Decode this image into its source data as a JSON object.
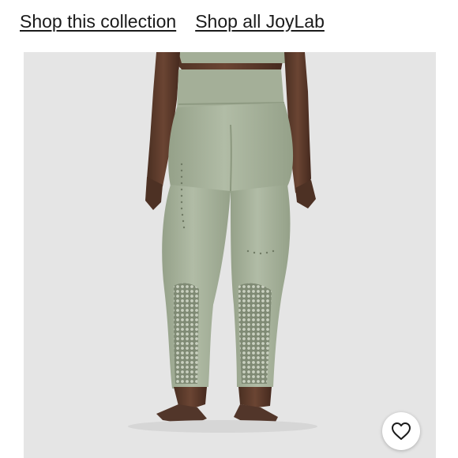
{
  "links": {
    "shop_collection": "Shop this collection",
    "shop_brand": "Shop all JoyLab"
  },
  "product_image": {
    "subject": "sage green seamless high-rise leggings, rear view",
    "background_color": "#e5e5e5",
    "garment_color": "#a8b39c"
  },
  "actions": {
    "like_icon": "heart-outline-icon"
  }
}
